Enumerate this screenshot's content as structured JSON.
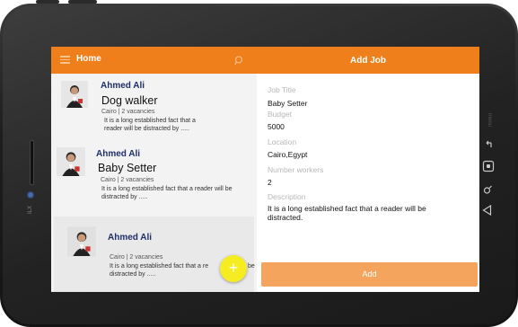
{
  "left_header": {
    "title": "Home"
  },
  "right_header": {
    "title": "Add Job"
  },
  "cards": [
    {
      "name": "Ahmed Ali",
      "job": "Dog walker",
      "meta": "Cairo | 2 vacancies",
      "desc_line1": "It is a long established fact that a",
      "desc_line2": "reader will be distracted by ....."
    },
    {
      "name": "Ahmed Ali",
      "job": "Baby Setter",
      "meta": "Cairo | 2 vacancies",
      "desc_line1": "It is a long established fact that a reader will be",
      "desc_line2": "distracted by ....."
    },
    {
      "name": "Ahmed Ali",
      "meta": "Cairo | 2 vacancies",
      "desc_line1": "It is a long established fact that a re",
      "desc_line1_tail": "be",
      "desc_line2": "distracted by ....."
    }
  ],
  "fab": {
    "label": "+"
  },
  "form": {
    "job_title_label": "Job Title",
    "job_title_value": "Baby Setter",
    "budget_label": "Budget",
    "budget_value": "5000",
    "location_label": "Location",
    "location_value": "Cairo,Egypt",
    "workers_label": "Number workers",
    "workers_value": "2",
    "description_label": "Description",
    "description_value": "It is a long established fact that a reader will be distracted.",
    "submit_label": "Add"
  },
  "device": {
    "side_label": "menu",
    "brand_label": "ILX"
  },
  "colors": {
    "accent": "#ef7f1a",
    "button": "#f4a45d",
    "fab": "#f6ec22",
    "name": "#1f2f6a"
  }
}
